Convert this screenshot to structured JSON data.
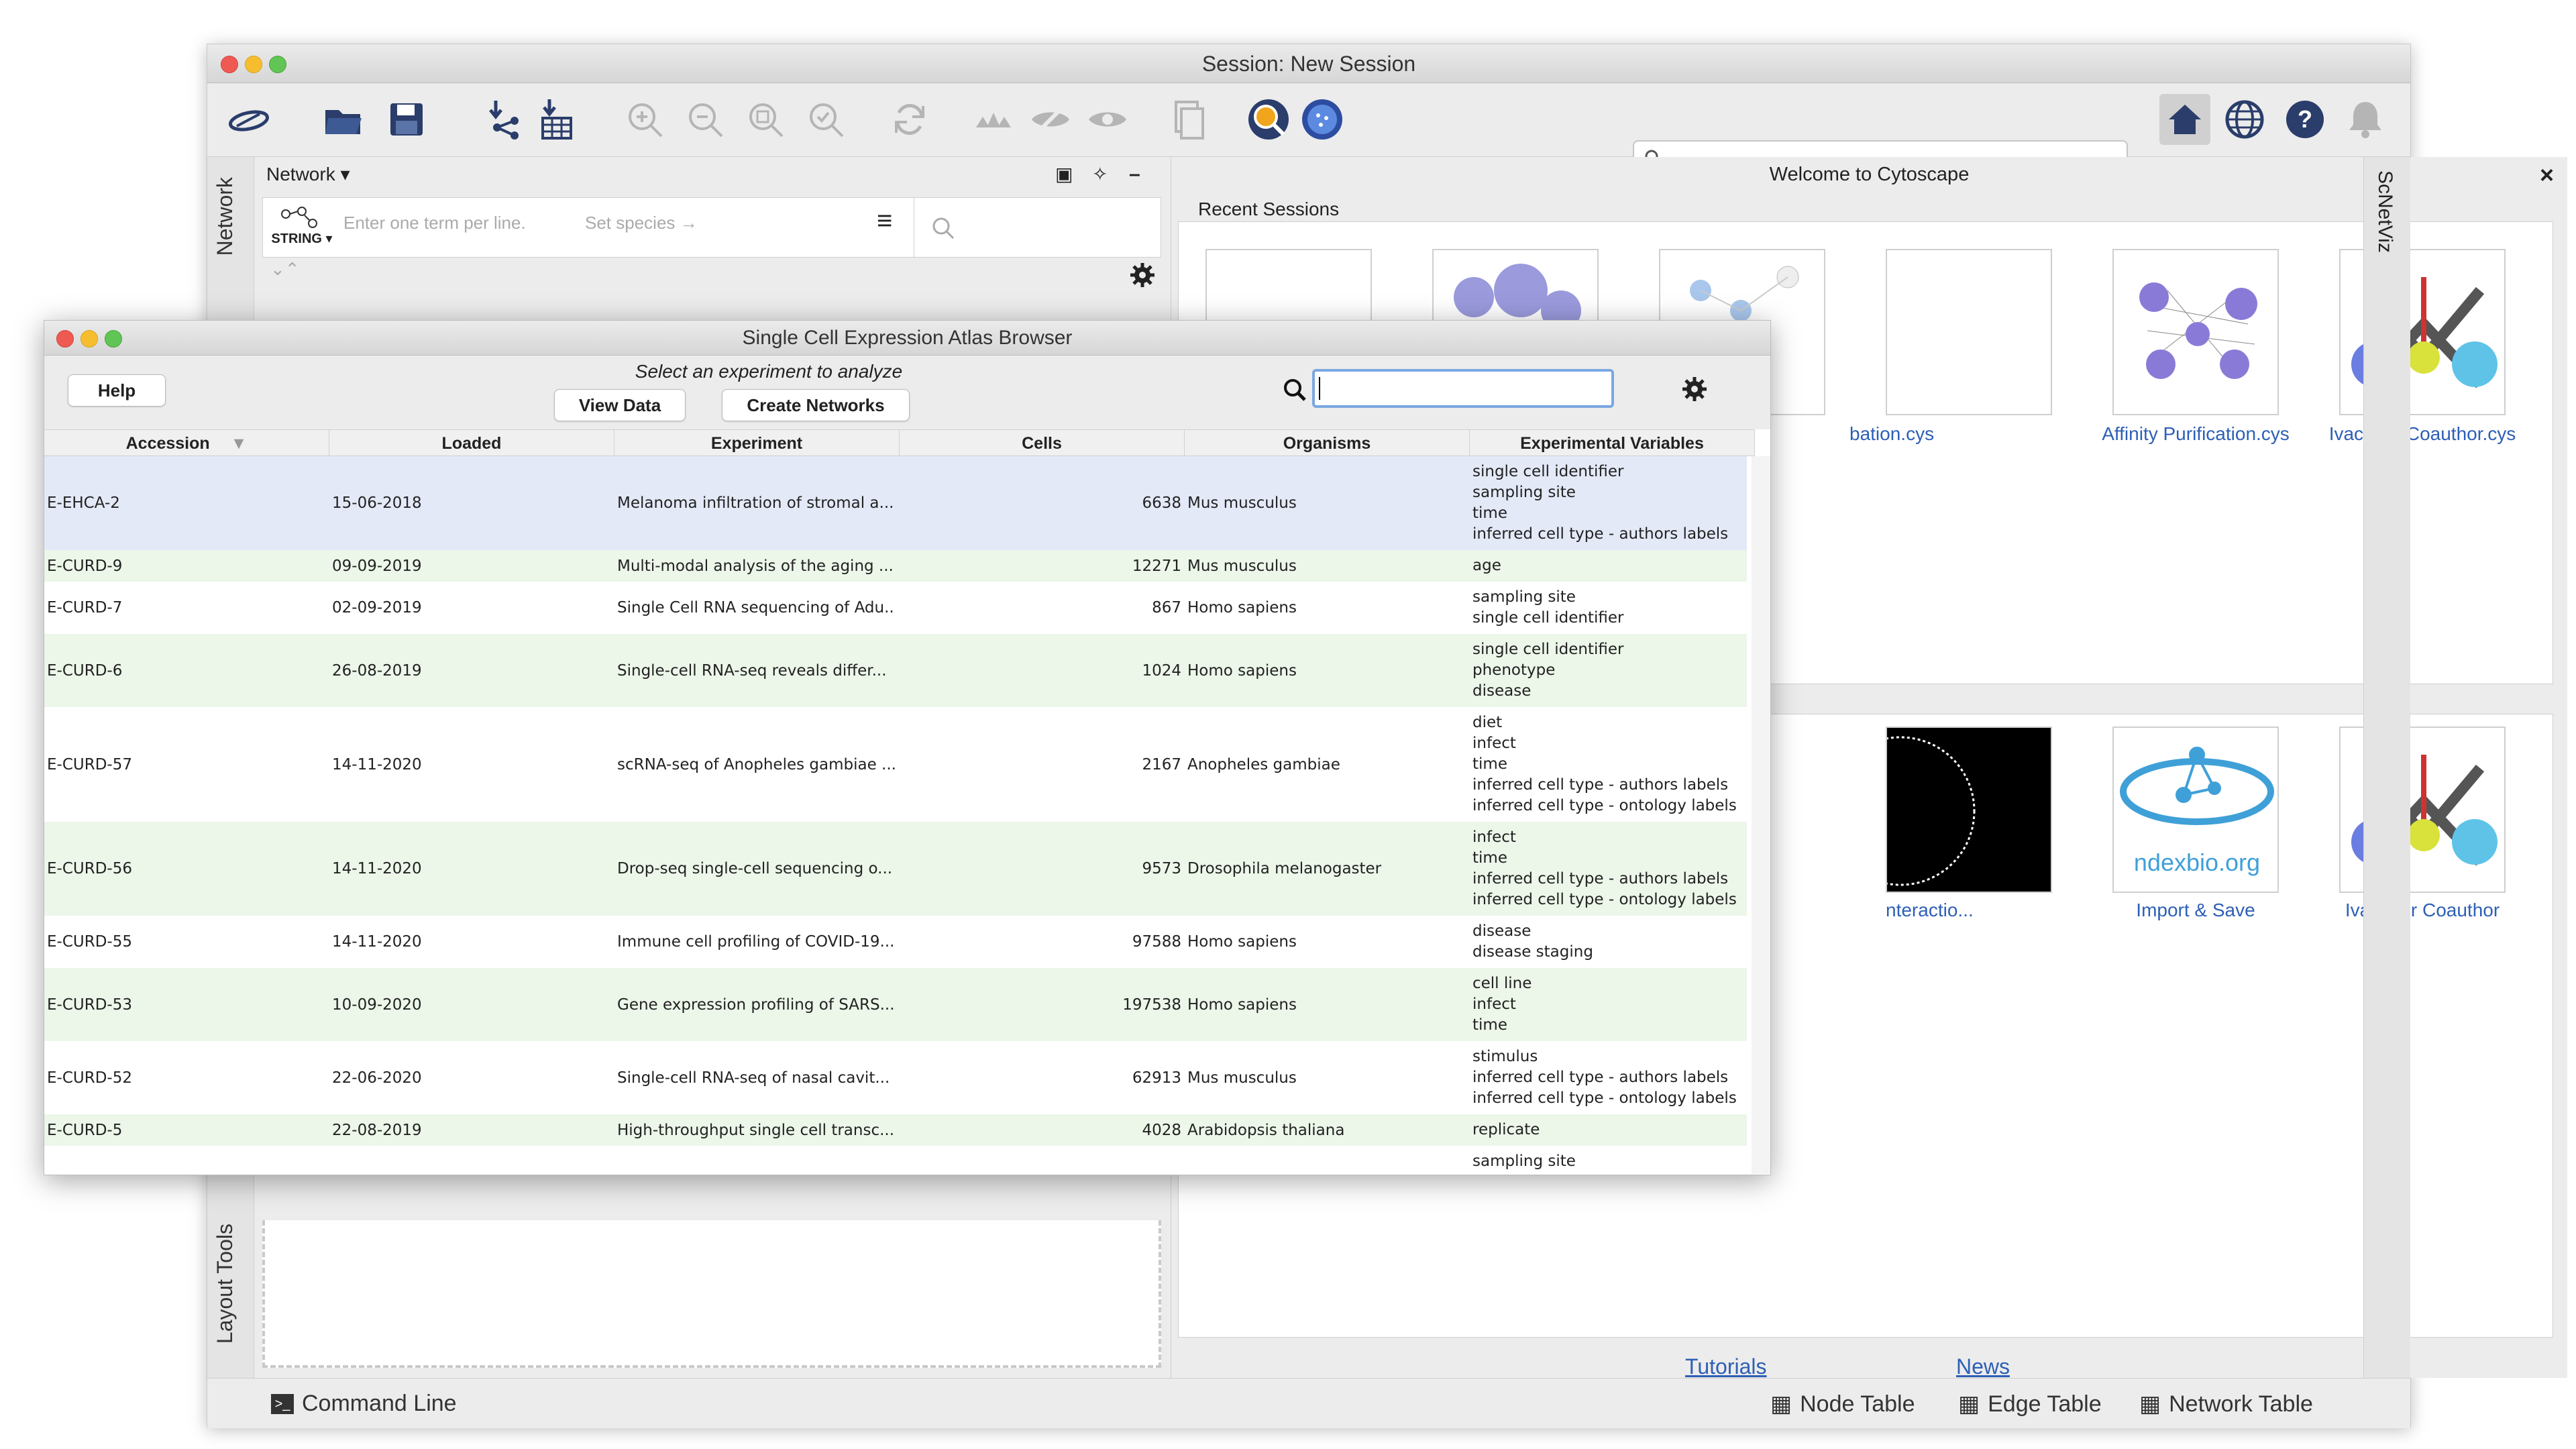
{
  "main_window": {
    "title": "Session: New Session",
    "search_placeholder": "",
    "left_panel": {
      "network_tab": "Network",
      "panel_title": "Network",
      "string_label": "STRING",
      "query_placeholder": "Enter one term per line.",
      "species_placeholder": "Set species →",
      "layout_tools_tab": "Layout Tools"
    },
    "welcome": {
      "title": "Welcome to Cytoscape",
      "close": "×",
      "recent_sessions_label": "Recent Sessions",
      "recent_items": [
        "bation.cys",
        "Affinity Purification.cys",
        "Ivacaftor Coauthor.cys"
      ],
      "example_items": [
        "nteractio...",
        "Import & Save",
        "Ivacaftor Coauthor"
      ],
      "ndex_logo_text": "ndexbio.org",
      "links": {
        "tutorials": "Tutorials",
        "news": "News"
      }
    },
    "right_strip_label": "ScNetViz",
    "status_bar": {
      "command_line": "Command Line",
      "node_table": "Node Table",
      "edge_table": "Edge Table",
      "network_table": "Network Table"
    }
  },
  "scea_browser": {
    "title": "Single Cell Expression Atlas Browser",
    "help_button": "Help",
    "instruction": "Select an experiment to analyze",
    "view_data_button": "View Data",
    "create_networks_button": "Create Networks",
    "columns": [
      "Accession",
      "Loaded",
      "Experiment",
      "Cells",
      "Organisms",
      "Experimental Variables"
    ],
    "rows": [
      {
        "accession": "E-EHCA-2",
        "loaded": "15-06-2018",
        "experiment": "Melanoma infiltration of stromal a...",
        "cells": "6638",
        "organism": "Mus musculus",
        "vars": [
          "single cell identifier",
          "sampling site",
          "time",
          "inferred cell type - authors labels"
        ]
      },
      {
        "accession": "E-CURD-9",
        "loaded": "09-09-2019",
        "experiment": "Multi-modal analysis of the aging ...",
        "cells": "12271",
        "organism": "Mus musculus",
        "vars": [
          "age"
        ]
      },
      {
        "accession": "E-CURD-7",
        "loaded": "02-09-2019",
        "experiment": "Single Cell RNA sequencing of Adu...",
        "cells": "867",
        "organism": "Homo sapiens",
        "vars": [
          "sampling site",
          "single cell identifier"
        ]
      },
      {
        "accession": "E-CURD-6",
        "loaded": "26-08-2019",
        "experiment": "Single-cell RNA-seq reveals differ...",
        "cells": "1024",
        "organism": "Homo sapiens",
        "vars": [
          "single cell identifier",
          "phenotype",
          "disease"
        ]
      },
      {
        "accession": "E-CURD-57",
        "loaded": "14-11-2020",
        "experiment": "scRNA-seq of Anopheles gambiae ...",
        "cells": "2167",
        "organism": "Anopheles gambiae",
        "vars": [
          "diet",
          "infect",
          "time",
          "inferred cell type - authors labels",
          "inferred cell type - ontology labels"
        ]
      },
      {
        "accession": "E-CURD-56",
        "loaded": "14-11-2020",
        "experiment": "Drop-seq single-cell sequencing o...",
        "cells": "9573",
        "organism": "Drosophila melanogaster",
        "vars": [
          "infect",
          "time",
          "inferred cell type - authors labels",
          "inferred cell type - ontology labels"
        ]
      },
      {
        "accession": "E-CURD-55",
        "loaded": "14-11-2020",
        "experiment": "Immune cell profiling of COVID-19...",
        "cells": "97588",
        "organism": "Homo sapiens",
        "vars": [
          "disease",
          "disease staging"
        ]
      },
      {
        "accession": "E-CURD-53",
        "loaded": "10-09-2020",
        "experiment": "Gene expression profiling of SARS...",
        "cells": "197538",
        "organism": "Homo sapiens",
        "vars": [
          "cell line",
          "infect",
          "time"
        ]
      },
      {
        "accession": "E-CURD-52",
        "loaded": "22-06-2020",
        "experiment": "Single-cell RNA-seq of nasal cavit...",
        "cells": "62913",
        "organism": "Mus musculus",
        "vars": [
          "stimulus",
          "inferred cell type - authors labels",
          "inferred cell type - ontology labels"
        ]
      },
      {
        "accession": "E-CURD-5",
        "loaded": "22-08-2019",
        "experiment": "High-throughput single cell transc...",
        "cells": "4028",
        "organism": "Arabidopsis thaliana",
        "vars": [
          "replicate"
        ]
      },
      {
        "accession": "",
        "loaded": "",
        "experiment": "",
        "cells": "",
        "organism": "",
        "vars": [
          "sampling site"
        ]
      }
    ],
    "selected_row": 0,
    "colors": {
      "selected": "#e4e9f8",
      "alt": "#ecf6e9",
      "plain": "#ffffff"
    }
  }
}
